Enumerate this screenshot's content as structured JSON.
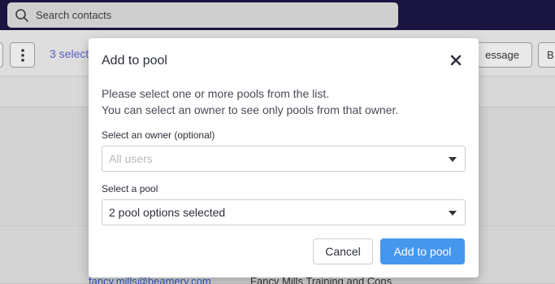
{
  "background": {
    "search_placeholder": "Search contacts",
    "selected_count": "3 select",
    "send_message_label": "essage",
    "right_button_label": "B",
    "row_email": "fancy.mills@beamery.com",
    "row_company": "Fancy Mills Training and Cons"
  },
  "modal": {
    "title": "Add to pool",
    "description_line1": "Please select one or more pools from the list.",
    "description_line2": "You can select an owner to see only pools from that owner.",
    "owner_label": "Select an owner (optional)",
    "owner_placeholder": "All users",
    "pool_label": "Select a pool",
    "pool_value": "2 pool options selected",
    "cancel_label": "Cancel",
    "submit_label": "Add to pool"
  },
  "colors": {
    "primary": "#4597ee",
    "topbar": "#1a1440",
    "selected_text": "#5b5fc7"
  }
}
